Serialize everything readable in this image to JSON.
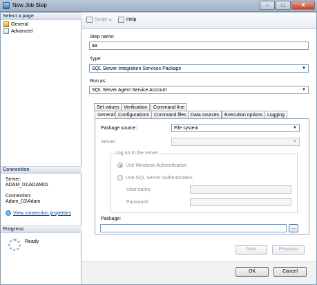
{
  "window": {
    "title": "New Job Step",
    "controls": {
      "minimize": "–",
      "maximize": "□",
      "close": "✕"
    }
  },
  "left": {
    "select_page_header": "Select a page",
    "pages": [
      {
        "label": "General"
      },
      {
        "label": "Advanced"
      }
    ],
    "connection_header": "Connection",
    "server_label": "Server:",
    "server_value": "ADAM_01\\ADAM01",
    "connection_label": "Connection:",
    "connection_value": "Adam_01\\Adam",
    "view_connection_link": "View connection properties",
    "progress_header": "Progress",
    "progress_status": "Ready"
  },
  "toolbar": {
    "script_label": "Script",
    "script_arrow": "▾",
    "help_label": "Help"
  },
  "form": {
    "step_name_label": "Step name:",
    "step_name_value": "aa",
    "type_label": "Type:",
    "type_value": "SQL Server Integration Services Package",
    "run_as_label": "Run as:",
    "run_as_value": "SQL Server Agent Service Account"
  },
  "tabs_row1": [
    "Set values",
    "Verification",
    "Command line"
  ],
  "tabs_row2": [
    "General",
    "Configurations",
    "Command files",
    "Data sources",
    "Execution options",
    "Logging"
  ],
  "general_tab": {
    "package_source_label": "Package source:",
    "package_source_value": "File system",
    "server_label": "Server:",
    "server_value": "",
    "logon_group_title": "Log on to the server",
    "windows_auth_label": "Use Windows Authentication",
    "sql_auth_label": "Use SQL Server Authentication",
    "user_name_label": "User name:",
    "password_label": "Password:",
    "package_label": "Package:",
    "package_value": "",
    "browse_label": "..."
  },
  "nav_buttons": {
    "next": "Next",
    "previous": "Previous"
  },
  "dialog_buttons": {
    "ok": "OK",
    "cancel": "Cancel"
  },
  "dropdown_arrow": "▼"
}
